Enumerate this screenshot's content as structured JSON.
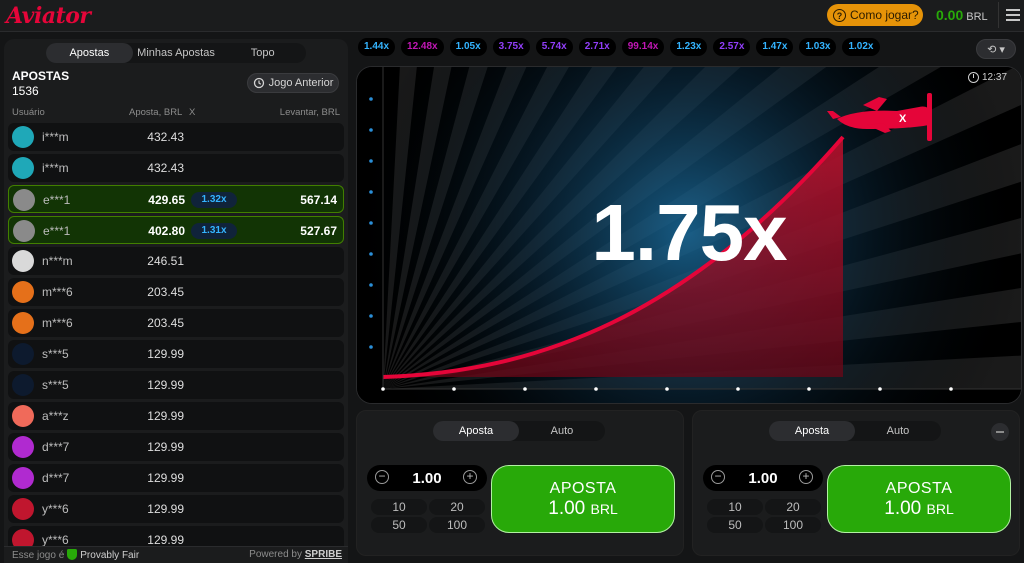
{
  "app": {
    "logo": "Aviator",
    "how_to_play": "Como jogar?",
    "balance": "0.00",
    "currency": "BRL"
  },
  "bets_panel": {
    "tabs": [
      "Apostas",
      "Minhas Apostas",
      "Topo"
    ],
    "title": "APOSTAS",
    "count": "1536",
    "prev_round_label": "Jogo Anterior",
    "columns": {
      "user": "Usuário",
      "bet": "Aposta, BRL",
      "x": "X",
      "cashout": "Levantar, BRL"
    },
    "rows": [
      {
        "user": "i***m",
        "bet": "432.43",
        "mult": "",
        "win": "",
        "avatar": "#1fa8b8"
      },
      {
        "user": "i***m",
        "bet": "432.43",
        "mult": "",
        "win": "",
        "avatar": "#1fa8b8"
      },
      {
        "user": "e***1",
        "bet": "429.65",
        "mult": "1.32x",
        "win": "567.14",
        "avatar": "#8a8a8a"
      },
      {
        "user": "e***1",
        "bet": "402.80",
        "mult": "1.31x",
        "win": "527.67",
        "avatar": "#8a8a8a"
      },
      {
        "user": "n***m",
        "bet": "246.51",
        "mult": "",
        "win": "",
        "avatar": "#d9d9d9"
      },
      {
        "user": "m***6",
        "bet": "203.45",
        "mult": "",
        "win": "",
        "avatar": "#e5701a"
      },
      {
        "user": "m***6",
        "bet": "203.45",
        "mult": "",
        "win": "",
        "avatar": "#e5701a"
      },
      {
        "user": "s***5",
        "bet": "129.99",
        "mult": "",
        "win": "",
        "avatar": "#0d1a2e"
      },
      {
        "user": "s***5",
        "bet": "129.99",
        "mult": "",
        "win": "",
        "avatar": "#0d1a2e"
      },
      {
        "user": "a***z",
        "bet": "129.99",
        "mult": "",
        "win": "",
        "avatar": "#f06a5a"
      },
      {
        "user": "d***7",
        "bet": "129.99",
        "mult": "",
        "win": "",
        "avatar": "#b02ad0"
      },
      {
        "user": "d***7",
        "bet": "129.99",
        "mult": "",
        "win": "",
        "avatar": "#b02ad0"
      },
      {
        "user": "y***6",
        "bet": "129.99",
        "mult": "",
        "win": "",
        "avatar": "#c0162e"
      },
      {
        "user": "y***6",
        "bet": "129.99",
        "mult": "",
        "win": "",
        "avatar": "#c0162e"
      }
    ],
    "footer_text": "Esse jogo é",
    "footer_fair": "Provably Fair",
    "powered_by": "Powered by",
    "powered_brand": "SPRIBE"
  },
  "history": [
    {
      "value": "1.44x",
      "color": "#34b4ff"
    },
    {
      "value": "12.48x",
      "color": "#c017b4"
    },
    {
      "value": "1.05x",
      "color": "#34b4ff"
    },
    {
      "value": "3.75x",
      "color": "#913ef8"
    },
    {
      "value": "5.74x",
      "color": "#913ef8"
    },
    {
      "value": "2.71x",
      "color": "#913ef8"
    },
    {
      "value": "99.14x",
      "color": "#c017b4"
    },
    {
      "value": "1.23x",
      "color": "#34b4ff"
    },
    {
      "value": "2.57x",
      "color": "#913ef8"
    },
    {
      "value": "1.47x",
      "color": "#34b4ff"
    },
    {
      "value": "1.03x",
      "color": "#34b4ff"
    },
    {
      "value": "1.02x",
      "color": "#34b4ff"
    }
  ],
  "game": {
    "multiplier": "1.75x",
    "time": "12:37"
  },
  "bet_panels": [
    {
      "tabs": [
        "Aposta",
        "Auto"
      ],
      "stake": "1.00",
      "quick": [
        "10",
        "20",
        "50",
        "100"
      ],
      "button_label": "APOSTA",
      "button_amount": "1.00",
      "button_currency": "BRL"
    },
    {
      "tabs": [
        "Aposta",
        "Auto"
      ],
      "stake": "1.00",
      "quick": [
        "10",
        "20",
        "50",
        "100"
      ],
      "button_label": "APOSTA",
      "button_amount": "1.00",
      "button_currency": "BRL"
    }
  ]
}
